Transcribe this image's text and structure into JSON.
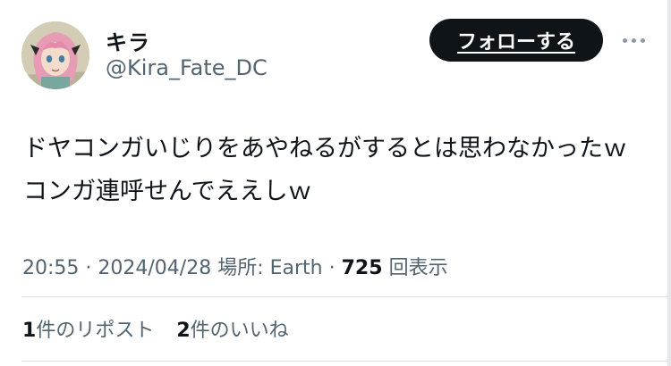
{
  "user": {
    "display_name": "キラ",
    "handle": "@Kira_Fate_DC",
    "avatar_icon": "anime-character-avatar"
  },
  "actions": {
    "follow_label": "フォローする",
    "more_icon": "more-horizontal-icon"
  },
  "tweet": {
    "lines": [
      "ドヤコンガいじりをあやねるがするとは思わなかったｗ",
      "コンガ連呼せんでええしｗ"
    ]
  },
  "meta": {
    "time": "20:55",
    "date": "2024/04/28",
    "location_label": "場所: Earth",
    "views_count": "725",
    "views_label": "回表示"
  },
  "stats": {
    "reposts_count": "1",
    "reposts_label": "件のリポスト",
    "likes_count": "2",
    "likes_label": "件のいいね"
  },
  "colors": {
    "text": "#0f1419",
    "secondary": "#536471",
    "button_bg": "#0f1419",
    "divider": "#d9dee2"
  }
}
